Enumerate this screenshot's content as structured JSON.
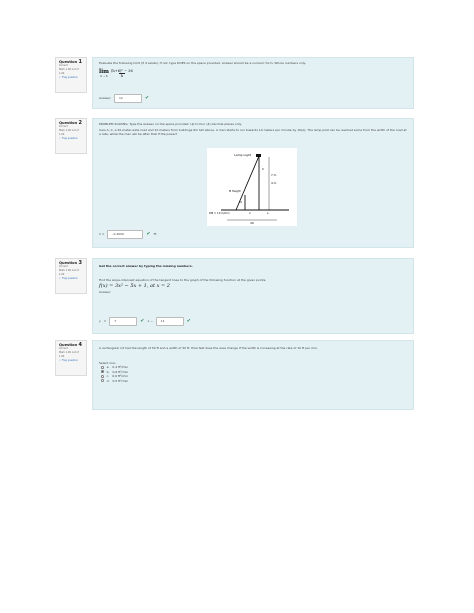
{
  "q1": {
    "label": "Question",
    "number": "1",
    "status": "Correct",
    "mark": "Mark 1.00 out of 1.00",
    "flag": "Flag question",
    "prompt": "Evaluate the following limit (if it exists). If not, type DOES on the space provided. Answer should be a numeric form. Whole numbers only.",
    "lim": "lim",
    "lim_sub": "h → 6",
    "numerator": "(h+6)² − 36",
    "denominator": "h",
    "answer_label": "Answer:",
    "answer_value": "12",
    "check": "✔"
  },
  "q2": {
    "label": "Question",
    "number": "2",
    "status": "Correct",
    "mark": "Mark 1.00 out of 1.00",
    "flag": "Flag question",
    "prompt1": "PROBLEM SOLVING. Type the answer on the space provided. Up to four (4) decimal places only.",
    "prompt2": "Cars A, C, a 20-meter-wide road and 10 meters from buildings 6m tall above. A man starts to run towards 10 meters per minute by 10(A). The lamp post can be reached some from the width of the road at a rate, while the man will be after that if the power?",
    "figure": {
      "lamp_label": "Lamp Light",
      "h_label": "7 m",
      "c_label": "C",
      "dim_label": "4 m",
      "man_label": "M",
      "mhight_label": "M Height",
      "x_label": "x",
      "s_label": "s",
      "ground_label": "DM = 10 m/min",
      "base_label": "20"
    },
    "answer_prefix": "1 =",
    "answer_value": "-0.4000",
    "check": "✔",
    "unit": "Ft"
  },
  "q3": {
    "label": "Question",
    "number": "3",
    "status": "Correct",
    "mark": "Mark 1.00 out of 1.00",
    "flag": "Flag question",
    "heading": "Get the correct answer by typing the missing numbers.",
    "prompt": "Find the slope-intercept equation of the tangent lines to the graph of the following function at the given points.",
    "function": "f(x) = 3x² − 5x + 1, at x = 2",
    "answer_label": "Answer:",
    "y_label": "y",
    "eq": "=",
    "slope_value": "7",
    "x_label": "x −",
    "intercept_value": "11",
    "check": "✔"
  },
  "q4": {
    "label": "Question",
    "number": "4",
    "status": "Correct",
    "mark": "Mark 1.00 out of 1.00",
    "flag": "Flag question",
    "prompt": "A rectangular lot had the length of 50 ft and a width of 30 ft. How fast does the area change if the width is increasing at the rate of 10 ft per min.",
    "select_label": "Select one:",
    "options": [
      {
        "letter": "a.",
        "text": "0.4 ft²/min"
      },
      {
        "letter": "b.",
        "text": "0.6 ft²/min"
      },
      {
        "letter": "c.",
        "text": "0.6 ft²/min"
      },
      {
        "letter": "d.",
        "text": "0.5 ft²/min"
      }
    ]
  }
}
